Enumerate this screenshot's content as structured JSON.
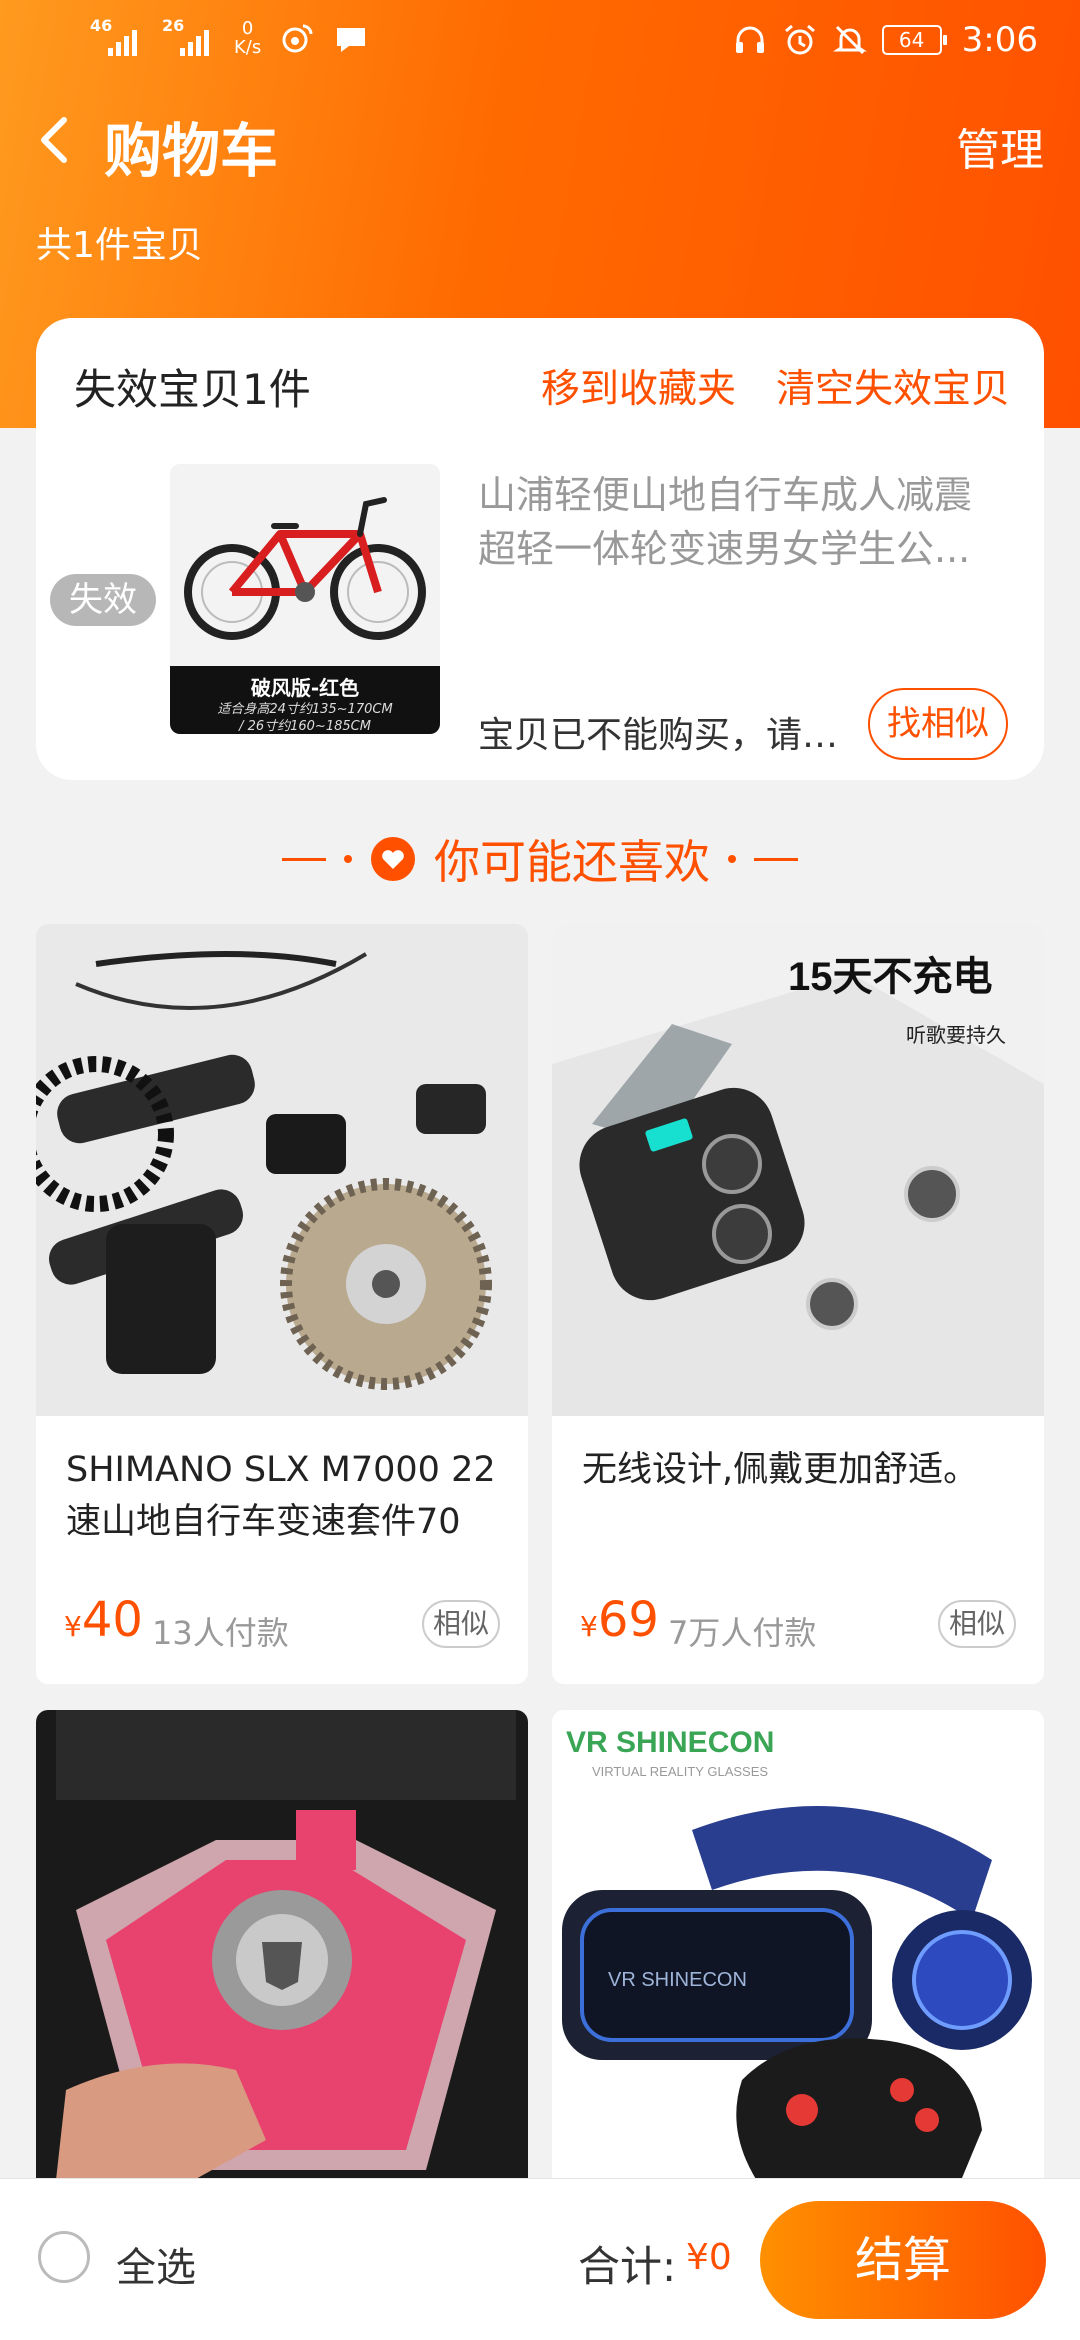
{
  "status_bar": {
    "net1": "46",
    "net2": "26",
    "speed_value": "0",
    "speed_unit": "K/s",
    "battery": "64",
    "time": "3:06"
  },
  "header": {
    "title": "购物车",
    "manage": "管理",
    "subtitle": "共1件宝贝"
  },
  "invalid_section": {
    "heading": "失效宝贝1件",
    "move_to_favorites": "移到收藏夹",
    "clear_invalid": "清空失效宝贝",
    "item": {
      "status_tag": "失效",
      "image_caption": "破风版-红色",
      "image_subcaption_1": "适合身高24寸约135~170CM",
      "image_subcaption_2": "/ 26寸约160~185CM",
      "name": "山浦轻便山地自行车成人减震超轻一体轮变速男女学生公...",
      "note": "宝贝已不能购买，请联...",
      "find_similar": "找相似"
    }
  },
  "recommendations": {
    "title": "你可能还喜欢",
    "products": [
      {
        "name": "SHIMANO SLX M7000 22速山地自行车变速套件70",
        "currency": "¥",
        "price": "40",
        "paid": "13人付款",
        "similar": "相似"
      },
      {
        "name": "无线设计,佩戴更加舒适。",
        "currency": "¥",
        "price": "69",
        "paid": "7万人付款",
        "similar": "相似",
        "image_text_1": "15天不充电",
        "image_text_2": "听歌要持久"
      },
      {
        "name": "",
        "image_text_1": ""
      },
      {
        "name": "",
        "image_text_1": "VR SHINECON",
        "image_text_2": "VIRTUAL REALITY GLASSES",
        "image_text_3": "VR SHINECON"
      }
    ]
  },
  "bottom_bar": {
    "select_all": "全选",
    "total_label": "合计:",
    "total_value": "¥0",
    "checkout": "结算"
  },
  "colors": {
    "accent": "#ff5000",
    "header_start": "#ff9a1f",
    "header_end": "#ff5000"
  }
}
